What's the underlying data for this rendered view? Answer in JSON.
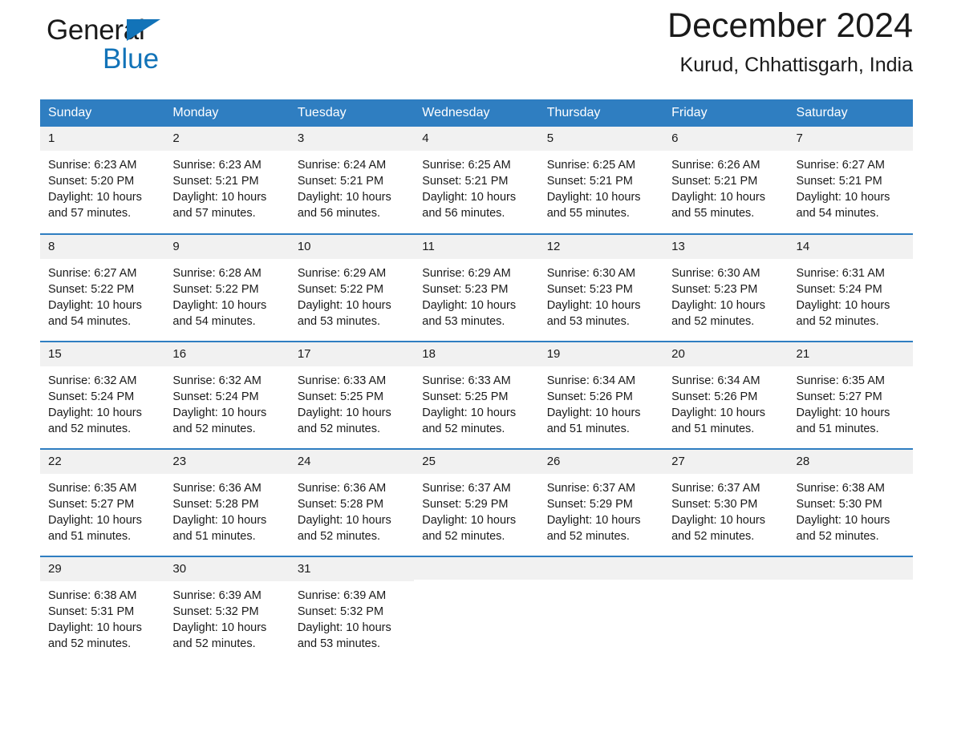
{
  "brand": {
    "name_part1": "General",
    "name_part2": "Blue",
    "accent_color": "#1273b8"
  },
  "header": {
    "title": "December 2024",
    "subtitle": "Kurud, Chhattisgarh, India"
  },
  "calendar": {
    "header_bg": "#2f7ec1",
    "row_border_color": "#2f7ec1",
    "daynum_bg": "#f1f1f1",
    "weekdays": [
      "Sunday",
      "Monday",
      "Tuesday",
      "Wednesday",
      "Thursday",
      "Friday",
      "Saturday"
    ],
    "weeks": [
      [
        {
          "day": "1",
          "sunrise": "Sunrise: 6:23 AM",
          "sunset": "Sunset: 5:20 PM",
          "daylight_line1": "Daylight: 10 hours",
          "daylight_line2": "and 57 minutes."
        },
        {
          "day": "2",
          "sunrise": "Sunrise: 6:23 AM",
          "sunset": "Sunset: 5:21 PM",
          "daylight_line1": "Daylight: 10 hours",
          "daylight_line2": "and 57 minutes."
        },
        {
          "day": "3",
          "sunrise": "Sunrise: 6:24 AM",
          "sunset": "Sunset: 5:21 PM",
          "daylight_line1": "Daylight: 10 hours",
          "daylight_line2": "and 56 minutes."
        },
        {
          "day": "4",
          "sunrise": "Sunrise: 6:25 AM",
          "sunset": "Sunset: 5:21 PM",
          "daylight_line1": "Daylight: 10 hours",
          "daylight_line2": "and 56 minutes."
        },
        {
          "day": "5",
          "sunrise": "Sunrise: 6:25 AM",
          "sunset": "Sunset: 5:21 PM",
          "daylight_line1": "Daylight: 10 hours",
          "daylight_line2": "and 55 minutes."
        },
        {
          "day": "6",
          "sunrise": "Sunrise: 6:26 AM",
          "sunset": "Sunset: 5:21 PM",
          "daylight_line1": "Daylight: 10 hours",
          "daylight_line2": "and 55 minutes."
        },
        {
          "day": "7",
          "sunrise": "Sunrise: 6:27 AM",
          "sunset": "Sunset: 5:21 PM",
          "daylight_line1": "Daylight: 10 hours",
          "daylight_line2": "and 54 minutes."
        }
      ],
      [
        {
          "day": "8",
          "sunrise": "Sunrise: 6:27 AM",
          "sunset": "Sunset: 5:22 PM",
          "daylight_line1": "Daylight: 10 hours",
          "daylight_line2": "and 54 minutes."
        },
        {
          "day": "9",
          "sunrise": "Sunrise: 6:28 AM",
          "sunset": "Sunset: 5:22 PM",
          "daylight_line1": "Daylight: 10 hours",
          "daylight_line2": "and 54 minutes."
        },
        {
          "day": "10",
          "sunrise": "Sunrise: 6:29 AM",
          "sunset": "Sunset: 5:22 PM",
          "daylight_line1": "Daylight: 10 hours",
          "daylight_line2": "and 53 minutes."
        },
        {
          "day": "11",
          "sunrise": "Sunrise: 6:29 AM",
          "sunset": "Sunset: 5:23 PM",
          "daylight_line1": "Daylight: 10 hours",
          "daylight_line2": "and 53 minutes."
        },
        {
          "day": "12",
          "sunrise": "Sunrise: 6:30 AM",
          "sunset": "Sunset: 5:23 PM",
          "daylight_line1": "Daylight: 10 hours",
          "daylight_line2": "and 53 minutes."
        },
        {
          "day": "13",
          "sunrise": "Sunrise: 6:30 AM",
          "sunset": "Sunset: 5:23 PM",
          "daylight_line1": "Daylight: 10 hours",
          "daylight_line2": "and 52 minutes."
        },
        {
          "day": "14",
          "sunrise": "Sunrise: 6:31 AM",
          "sunset": "Sunset: 5:24 PM",
          "daylight_line1": "Daylight: 10 hours",
          "daylight_line2": "and 52 minutes."
        }
      ],
      [
        {
          "day": "15",
          "sunrise": "Sunrise: 6:32 AM",
          "sunset": "Sunset: 5:24 PM",
          "daylight_line1": "Daylight: 10 hours",
          "daylight_line2": "and 52 minutes."
        },
        {
          "day": "16",
          "sunrise": "Sunrise: 6:32 AM",
          "sunset": "Sunset: 5:24 PM",
          "daylight_line1": "Daylight: 10 hours",
          "daylight_line2": "and 52 minutes."
        },
        {
          "day": "17",
          "sunrise": "Sunrise: 6:33 AM",
          "sunset": "Sunset: 5:25 PM",
          "daylight_line1": "Daylight: 10 hours",
          "daylight_line2": "and 52 minutes."
        },
        {
          "day": "18",
          "sunrise": "Sunrise: 6:33 AM",
          "sunset": "Sunset: 5:25 PM",
          "daylight_line1": "Daylight: 10 hours",
          "daylight_line2": "and 52 minutes."
        },
        {
          "day": "19",
          "sunrise": "Sunrise: 6:34 AM",
          "sunset": "Sunset: 5:26 PM",
          "daylight_line1": "Daylight: 10 hours",
          "daylight_line2": "and 51 minutes."
        },
        {
          "day": "20",
          "sunrise": "Sunrise: 6:34 AM",
          "sunset": "Sunset: 5:26 PM",
          "daylight_line1": "Daylight: 10 hours",
          "daylight_line2": "and 51 minutes."
        },
        {
          "day": "21",
          "sunrise": "Sunrise: 6:35 AM",
          "sunset": "Sunset: 5:27 PM",
          "daylight_line1": "Daylight: 10 hours",
          "daylight_line2": "and 51 minutes."
        }
      ],
      [
        {
          "day": "22",
          "sunrise": "Sunrise: 6:35 AM",
          "sunset": "Sunset: 5:27 PM",
          "daylight_line1": "Daylight: 10 hours",
          "daylight_line2": "and 51 minutes."
        },
        {
          "day": "23",
          "sunrise": "Sunrise: 6:36 AM",
          "sunset": "Sunset: 5:28 PM",
          "daylight_line1": "Daylight: 10 hours",
          "daylight_line2": "and 51 minutes."
        },
        {
          "day": "24",
          "sunrise": "Sunrise: 6:36 AM",
          "sunset": "Sunset: 5:28 PM",
          "daylight_line1": "Daylight: 10 hours",
          "daylight_line2": "and 52 minutes."
        },
        {
          "day": "25",
          "sunrise": "Sunrise: 6:37 AM",
          "sunset": "Sunset: 5:29 PM",
          "daylight_line1": "Daylight: 10 hours",
          "daylight_line2": "and 52 minutes."
        },
        {
          "day": "26",
          "sunrise": "Sunrise: 6:37 AM",
          "sunset": "Sunset: 5:29 PM",
          "daylight_line1": "Daylight: 10 hours",
          "daylight_line2": "and 52 minutes."
        },
        {
          "day": "27",
          "sunrise": "Sunrise: 6:37 AM",
          "sunset": "Sunset: 5:30 PM",
          "daylight_line1": "Daylight: 10 hours",
          "daylight_line2": "and 52 minutes."
        },
        {
          "day": "28",
          "sunrise": "Sunrise: 6:38 AM",
          "sunset": "Sunset: 5:30 PM",
          "daylight_line1": "Daylight: 10 hours",
          "daylight_line2": "and 52 minutes."
        }
      ],
      [
        {
          "day": "29",
          "sunrise": "Sunrise: 6:38 AM",
          "sunset": "Sunset: 5:31 PM",
          "daylight_line1": "Daylight: 10 hours",
          "daylight_line2": "and 52 minutes."
        },
        {
          "day": "30",
          "sunrise": "Sunrise: 6:39 AM",
          "sunset": "Sunset: 5:32 PM",
          "daylight_line1": "Daylight: 10 hours",
          "daylight_line2": "and 52 minutes."
        },
        {
          "day": "31",
          "sunrise": "Sunrise: 6:39 AM",
          "sunset": "Sunset: 5:32 PM",
          "daylight_line1": "Daylight: 10 hours",
          "daylight_line2": "and 53 minutes."
        },
        {
          "day": "",
          "sunrise": "",
          "sunset": "",
          "daylight_line1": "",
          "daylight_line2": ""
        },
        {
          "day": "",
          "sunrise": "",
          "sunset": "",
          "daylight_line1": "",
          "daylight_line2": ""
        },
        {
          "day": "",
          "sunrise": "",
          "sunset": "",
          "daylight_line1": "",
          "daylight_line2": ""
        },
        {
          "day": "",
          "sunrise": "",
          "sunset": "",
          "daylight_line1": "",
          "daylight_line2": ""
        }
      ]
    ]
  }
}
